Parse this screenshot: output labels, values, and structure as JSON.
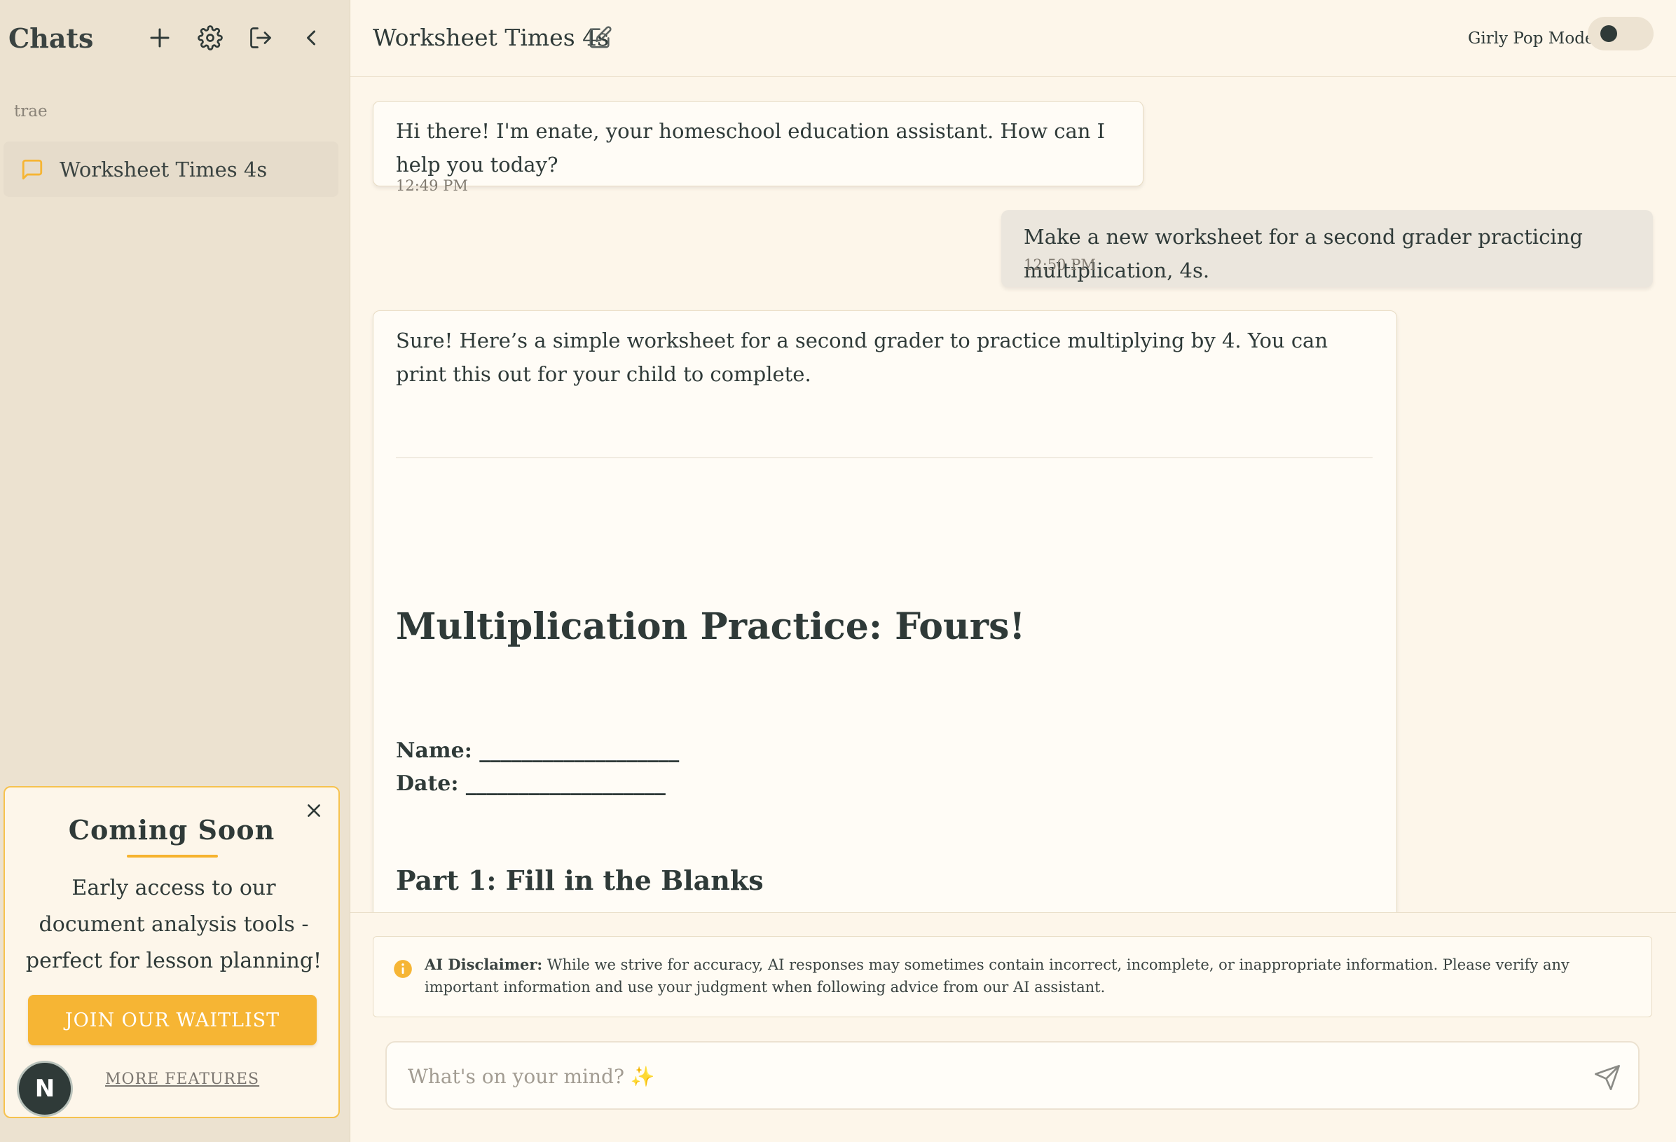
{
  "sidebar": {
    "title": "Chats",
    "user": "trae",
    "items": [
      {
        "label": "Worksheet Times 4s"
      }
    ]
  },
  "promo": {
    "title": "Coming Soon",
    "text": "Early access to our document analysis tools - perfect for lesson planning!",
    "join_label": "JOIN OUR WAITLIST",
    "more_label": "MORE FEATURES"
  },
  "avatar": {
    "initial": "N"
  },
  "header": {
    "title": "Worksheet Times 4s",
    "mode_label": "Girly Pop Mode",
    "mode_on": false
  },
  "messages": [
    {
      "role": "assistant",
      "text": "Hi there! I'm enate, your homeschool education assistant. How can I help you today?",
      "time": "12:49 PM"
    },
    {
      "role": "user",
      "text": "Make a new worksheet for a second grader practicing multiplication, 4s.",
      "time": "12:50 PM"
    },
    {
      "role": "assistant",
      "text": "Sure! Here’s a simple worksheet for a second grader to practice multiplying by 4. You can print this out for your child to complete."
    }
  ],
  "worksheet": {
    "title": "Multiplication Practice: Fours!",
    "name_line": "Name: ___________________",
    "date_line": "Date: ___________________",
    "part1": "Part 1: Fill in the Blanks"
  },
  "disclaimer": {
    "label": "AI Disclaimer:",
    "text": "While we strive for accuracy, AI responses may sometimes contain incorrect, incomplete, or inappropriate information. Please verify any important information and use your judgment when following advice from our AI assistant."
  },
  "composer": {
    "placeholder": "What's on your mind? ✨",
    "value": ""
  },
  "colors": {
    "accent": "#f6b534",
    "sidebar_bg": "#ece2d0",
    "page_bg": "#fdf6ea",
    "text": "#2f3a38"
  }
}
